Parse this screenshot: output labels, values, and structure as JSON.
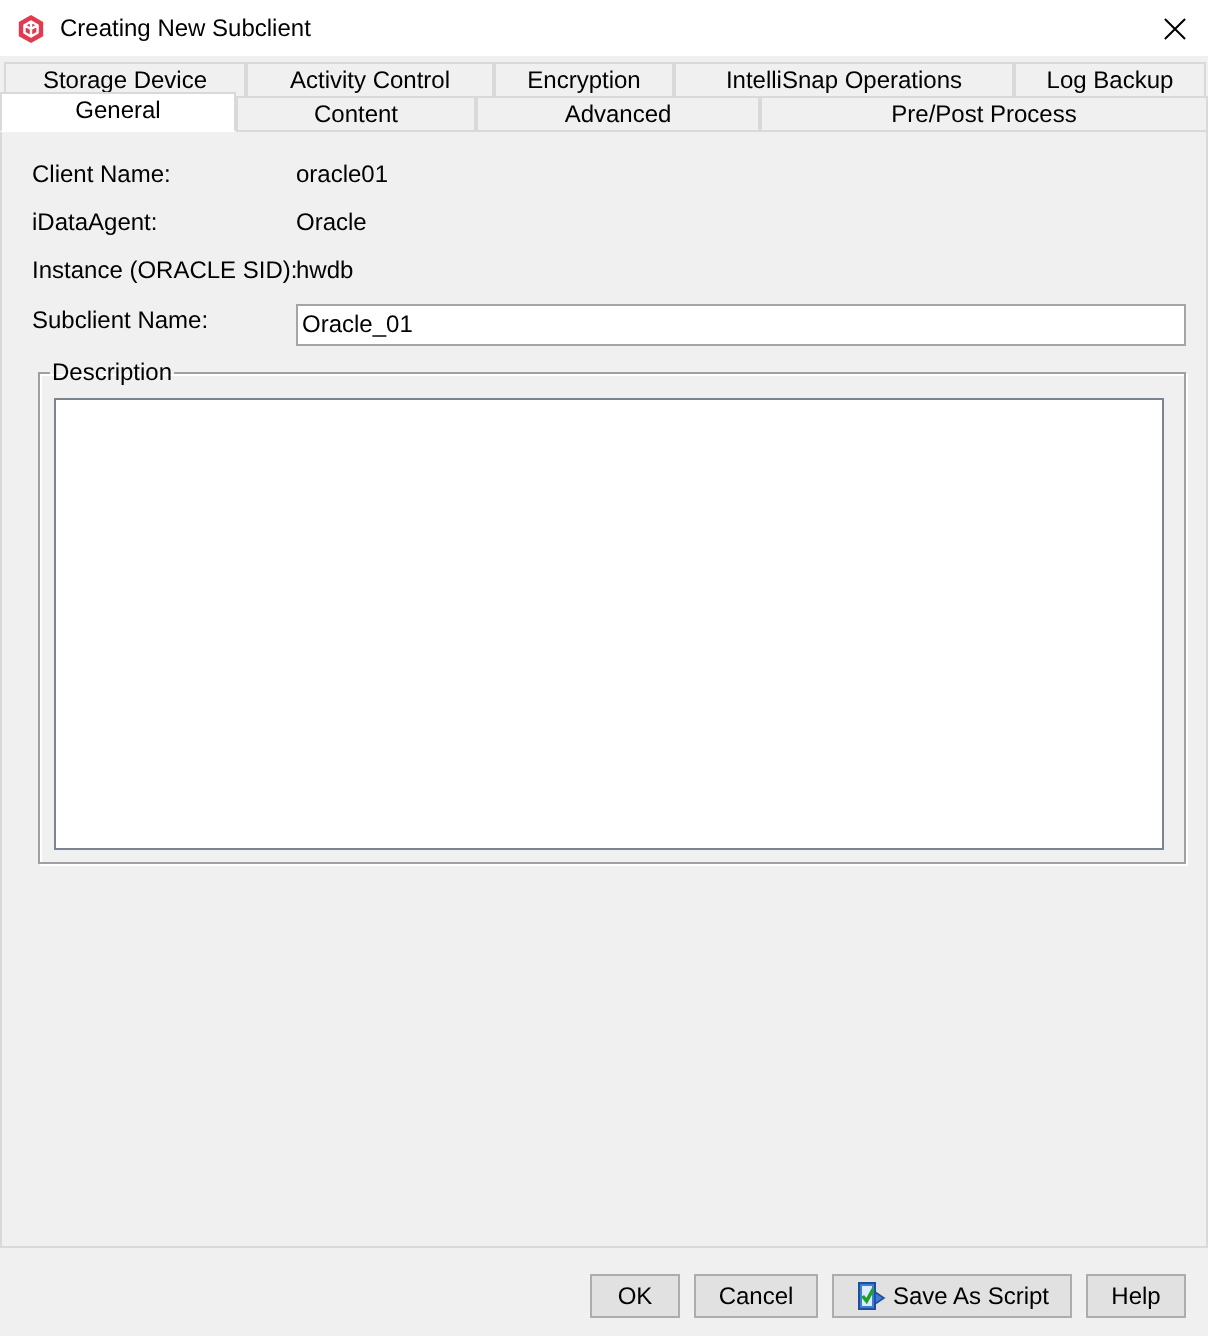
{
  "window": {
    "title": "Creating New Subclient"
  },
  "tab_rows": [
    [
      {
        "label": "Storage Device",
        "selected": false
      },
      {
        "label": "Activity Control",
        "selected": false
      },
      {
        "label": "Encryption",
        "selected": false
      },
      {
        "label": "IntelliSnap Operations",
        "selected": false
      },
      {
        "label": "Log Backup",
        "selected": false
      }
    ],
    [
      {
        "label": "General",
        "selected": true
      },
      {
        "label": "Content",
        "selected": false
      },
      {
        "label": "Advanced",
        "selected": false
      },
      {
        "label": "Pre/Post Process",
        "selected": false
      }
    ]
  ],
  "fields": [
    {
      "kind": "text",
      "label": "Client Name:",
      "value": "oracle01"
    },
    {
      "kind": "text",
      "label": "iDataAgent:",
      "value": "Oracle"
    },
    {
      "kind": "text",
      "label": "Instance (ORACLE SID):",
      "value": "hwdb"
    },
    {
      "kind": "input",
      "label": "Subclient Name:",
      "value": "Oracle_01"
    }
  ],
  "description": {
    "legend": "Description"
  },
  "buttons": [
    {
      "kind": "plain",
      "label": "OK"
    },
    {
      "kind": "plain",
      "label": "Cancel"
    },
    {
      "kind": "script",
      "label": "Save As Script"
    },
    {
      "kind": "plain",
      "label": "Help"
    }
  ]
}
